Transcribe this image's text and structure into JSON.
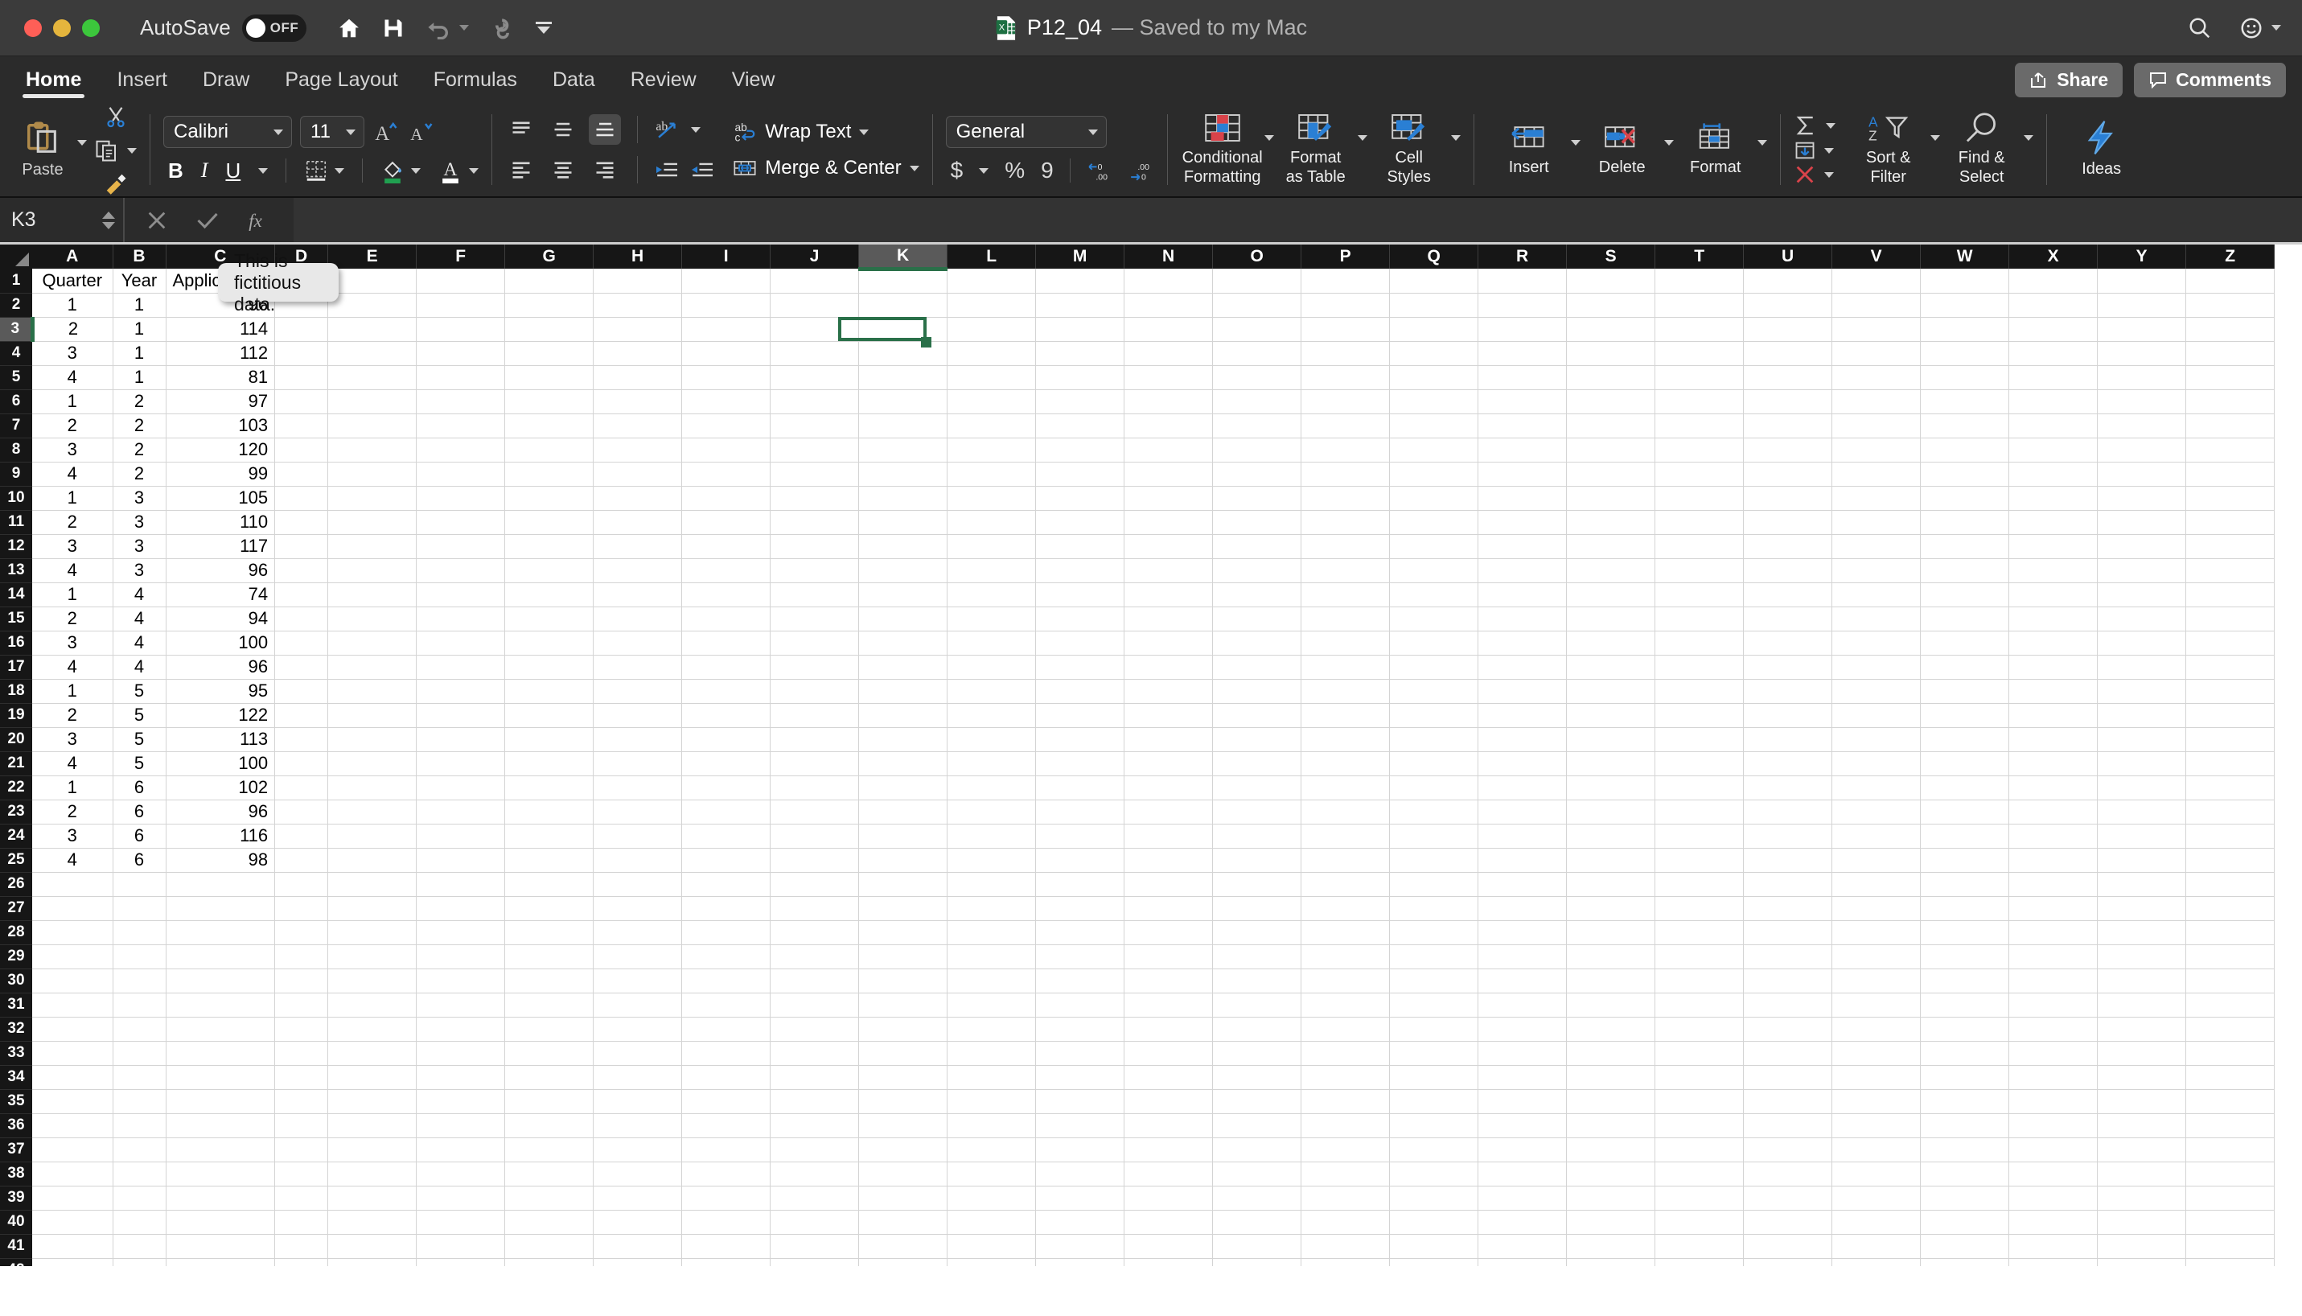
{
  "window": {
    "autosave_label": "AutoSave",
    "autosave_state": "OFF",
    "doc_name": "P12_04",
    "doc_status": "— Saved to my Mac",
    "traffic_lights": [
      "close",
      "minimize",
      "zoom"
    ]
  },
  "quick_access": [
    "home-icon",
    "save-icon",
    "undo-icon",
    "redo-icon",
    "customize-toolbar-icon"
  ],
  "title_right": [
    "search-icon",
    "account-icon"
  ],
  "tabs": [
    {
      "label": "Home",
      "active": true
    },
    {
      "label": "Insert",
      "active": false
    },
    {
      "label": "Draw",
      "active": false
    },
    {
      "label": "Page Layout",
      "active": false
    },
    {
      "label": "Formulas",
      "active": false
    },
    {
      "label": "Data",
      "active": false
    },
    {
      "label": "Review",
      "active": false
    },
    {
      "label": "View",
      "active": false
    }
  ],
  "tabbar_right": [
    {
      "label": "Share",
      "icon": "share-icon"
    },
    {
      "label": "Comments",
      "icon": "comment-icon"
    }
  ],
  "ribbon": {
    "clipboard": {
      "paste_label": "Paste",
      "cut_icon": "scissors-icon",
      "copy_icon": "copy-icon",
      "format_painter_icon": "format-painter-icon"
    },
    "font": {
      "font_family": "Calibri",
      "font_size": "11",
      "grow_font": "A^",
      "shrink_font": "Av",
      "bold": "B",
      "italic": "I",
      "underline": "U",
      "borders_icon": "borders-icon",
      "fill_color_icon": "fill-color-icon",
      "font_color_icon": "font-color-icon"
    },
    "alignment": {
      "top_align": "align-top-icon",
      "middle_align": "align-middle-icon",
      "bottom_align": "align-bottom-icon",
      "left_align": "align-left-icon",
      "center_align": "align-center-icon",
      "right_align": "align-right-icon",
      "orientation": "text-orientation-icon",
      "decrease_indent": "decrease-indent-icon",
      "increase_indent": "increase-indent-icon",
      "wrap_text_label": "Wrap Text",
      "merge_center_label": "Merge & Center"
    },
    "number": {
      "format": "General",
      "currency": "$",
      "percent": "%",
      "comma": "9",
      "decrease_decimal": "decrease-decimal-icon",
      "increase_decimal": "increase-decimal-icon"
    },
    "styles": [
      {
        "label": "Conditional\nFormatting",
        "line1": "Conditional",
        "line2": "Formatting",
        "icon": "conditional-formatting-icon"
      },
      {
        "label": "Format as Table",
        "line1": "Format",
        "line2": "as Table",
        "icon": "format-as-table-icon"
      },
      {
        "label": "Cell Styles",
        "line1": "Cell",
        "line2": "Styles",
        "icon": "cell-styles-icon"
      }
    ],
    "cells": [
      {
        "line1": "Insert",
        "line2": "",
        "icon": "insert-cells-icon"
      },
      {
        "line1": "Delete",
        "line2": "",
        "icon": "delete-cells-icon"
      },
      {
        "line1": "Format",
        "line2": "",
        "icon": "format-cells-icon"
      }
    ],
    "editing": {
      "autosum": "autosum-icon",
      "fill": "fill-down-icon",
      "clear": "clear-icon",
      "sort_filter_l1": "Sort &",
      "sort_filter_l2": "Filter",
      "find_select_l1": "Find &",
      "find_select_l2": "Select"
    },
    "ideas": {
      "label": "Ideas",
      "icon": "ideas-lightning-icon"
    }
  },
  "formula_bar": {
    "name_box": "K3",
    "cancel_icon": "cancel-icon",
    "enter_icon": "confirm-icon",
    "function_icon": "fx-icon",
    "formula_value": ""
  },
  "sheet": {
    "columns": [
      "A",
      "B",
      "C",
      "D",
      "E",
      "F",
      "G",
      "H",
      "I",
      "J",
      "K",
      "L",
      "M",
      "N",
      "O",
      "P",
      "Q",
      "R",
      "S",
      "T",
      "U",
      "V",
      "W",
      "X",
      "Y",
      "Z"
    ],
    "selected_column": "K",
    "selected_row": 3,
    "active_cell": "K3",
    "row_count": 42,
    "headers": [
      "Quarter",
      "Year",
      "Applications"
    ],
    "rows": [
      {
        "row": 1,
        "a": "Quarter",
        "b": "Year",
        "c": "Applications",
        "header": true
      },
      {
        "row": 2,
        "a": "1",
        "b": "1",
        "c": "96"
      },
      {
        "row": 3,
        "a": "2",
        "b": "1",
        "c": "114"
      },
      {
        "row": 4,
        "a": "3",
        "b": "1",
        "c": "112"
      },
      {
        "row": 5,
        "a": "4",
        "b": "1",
        "c": "81"
      },
      {
        "row": 6,
        "a": "1",
        "b": "2",
        "c": "97"
      },
      {
        "row": 7,
        "a": "2",
        "b": "2",
        "c": "103"
      },
      {
        "row": 8,
        "a": "3",
        "b": "2",
        "c": "120"
      },
      {
        "row": 9,
        "a": "4",
        "b": "2",
        "c": "99"
      },
      {
        "row": 10,
        "a": "1",
        "b": "3",
        "c": "105"
      },
      {
        "row": 11,
        "a": "2",
        "b": "3",
        "c": "110"
      },
      {
        "row": 12,
        "a": "3",
        "b": "3",
        "c": "117"
      },
      {
        "row": 13,
        "a": "4",
        "b": "3",
        "c": "96"
      },
      {
        "row": 14,
        "a": "1",
        "b": "4",
        "c": "74"
      },
      {
        "row": 15,
        "a": "2",
        "b": "4",
        "c": "94"
      },
      {
        "row": 16,
        "a": "3",
        "b": "4",
        "c": "100"
      },
      {
        "row": 17,
        "a": "4",
        "b": "4",
        "c": "96"
      },
      {
        "row": 18,
        "a": "1",
        "b": "5",
        "c": "95"
      },
      {
        "row": 19,
        "a": "2",
        "b": "5",
        "c": "122"
      },
      {
        "row": 20,
        "a": "3",
        "b": "5",
        "c": "113"
      },
      {
        "row": 21,
        "a": "4",
        "b": "5",
        "c": "100"
      },
      {
        "row": 22,
        "a": "1",
        "b": "6",
        "c": "102"
      },
      {
        "row": 23,
        "a": "2",
        "b": "6",
        "c": "96"
      },
      {
        "row": 24,
        "a": "3",
        "b": "6",
        "c": "116"
      },
      {
        "row": 25,
        "a": "4",
        "b": "6",
        "c": "98"
      }
    ],
    "comment_tooltip": {
      "text": "This is fictitious data.",
      "anchor_cell": "D1"
    }
  },
  "colors": {
    "titlebar_bg": "#3b3b3b",
    "ribbon_bg": "#2b2b2b",
    "header_bg": "#161616",
    "selection_green": "#2a7049",
    "accent_blue": "#2a7fd4",
    "accent_red": "#d9434a",
    "grid_line": "#d4d4d4"
  }
}
